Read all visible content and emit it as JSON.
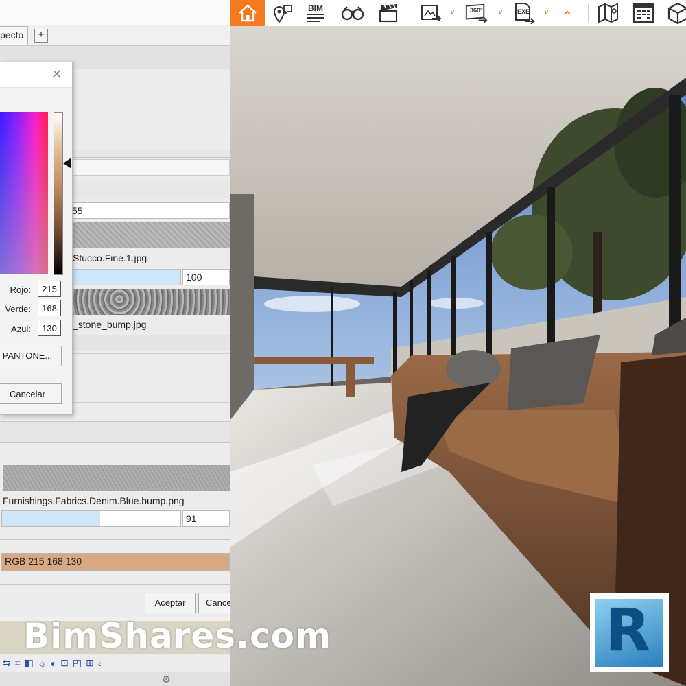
{
  "left_panel": {
    "tab_label": "pecto",
    "tab_add": "+",
    "fields": {
      "partial_value": "55",
      "texture1_file": "Stucco.Fine.1.jpg",
      "texture1_amount": "100",
      "texture2_file": "_stone_bump.jpg",
      "texture3_file": "Furnishings.Fabrics.Denim.Blue.bump.png",
      "texture3_amount": "91",
      "color_value": "RGB 215 168 130"
    },
    "buttons": {
      "accept": "Aceptar",
      "cancel_partial": "Cance"
    }
  },
  "color_dialog": {
    "close_symbol": "✕",
    "red_label": "Rojo:",
    "green_label": "Verde:",
    "blue_label": "Azul:",
    "red": "215",
    "green": "168",
    "blue": "130",
    "pantone_button": "PANTONE...",
    "cancel_button": "Cancelar"
  },
  "watermark": "BimShares.com",
  "colors": {
    "accent_orange": "#F47A20",
    "selected_color": "#D7A882",
    "slider_fill": "#CFE5F8"
  },
  "toolbar_icons": [
    "home-icon",
    "location-pin-icon",
    "bim-icon",
    "binoculars-icon",
    "clapperboard-icon",
    "export-image-icon",
    "export-360-icon",
    "export-exe-icon",
    "collapse-chevron-icon",
    "map-icon",
    "building-icon",
    "cube-icon"
  ],
  "toolbar_texts": {
    "bim": "BIM",
    "pano": "360°",
    "exe": "EXE"
  },
  "logo": {
    "letter": "R"
  }
}
